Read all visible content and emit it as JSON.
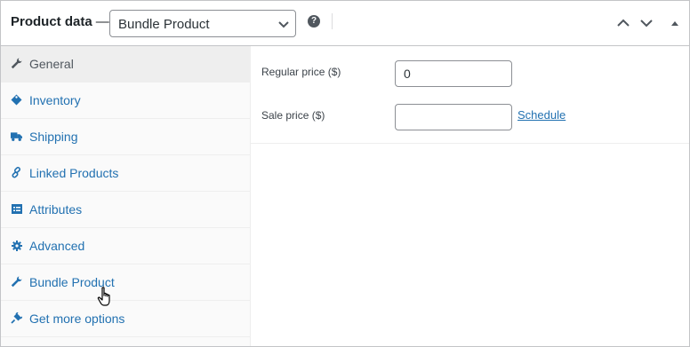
{
  "header": {
    "title": "Product data",
    "title_sep": "—",
    "product_type": "Bundle Product"
  },
  "sidebar": {
    "items": [
      {
        "label": "General",
        "icon": "wrench-icon",
        "active": true
      },
      {
        "label": "Inventory",
        "icon": "tag-icon"
      },
      {
        "label": "Shipping",
        "icon": "truck-icon"
      },
      {
        "label": "Linked Products",
        "icon": "link-icon"
      },
      {
        "label": "Attributes",
        "icon": "list-view-icon"
      },
      {
        "label": "Advanced",
        "icon": "gear-icon"
      },
      {
        "label": "Bundle Product",
        "icon": "wrench-icon"
      },
      {
        "label": "Get more options",
        "icon": "plugin-icon"
      }
    ]
  },
  "general": {
    "regular_price_label": "Regular price ($)",
    "regular_price_value": "0",
    "sale_price_label": "Sale price ($)",
    "sale_price_value": "",
    "schedule_label": "Schedule"
  },
  "colors": {
    "link": "#2271b1",
    "active_tab_bg": "#eeeeee",
    "sidebar_bg": "#fafafa",
    "border": "#c3c4c7"
  }
}
